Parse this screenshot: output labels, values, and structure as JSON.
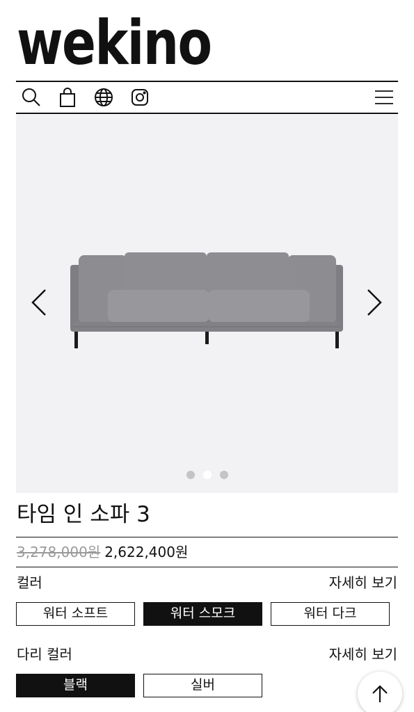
{
  "brand": {
    "logo_text": "wekino"
  },
  "toolbar": {
    "icons": [
      "search-icon",
      "shopping-bag-icon",
      "globe-icon",
      "instagram-icon",
      "hamburger-menu-icon"
    ]
  },
  "gallery": {
    "slide_count": 3,
    "active_slide": 2,
    "product_color": "#8a898e"
  },
  "product": {
    "name": "타임 인 소파 3",
    "original_price": "3,278,000원",
    "sale_price": "2,622,400원"
  },
  "options": {
    "color": {
      "label": "컬러",
      "detail_link": "자세히 보기",
      "choices": [
        "워터 소프트",
        "워터 스모크",
        "워터 다크"
      ],
      "selected": "워터 스모크"
    },
    "leg_color": {
      "label": "다리 컬러",
      "detail_link": "자세히 보기",
      "choices": [
        "블랙",
        "실버"
      ],
      "selected": "블랙"
    }
  },
  "scroll_top": {
    "icon": "arrow-up-icon"
  }
}
